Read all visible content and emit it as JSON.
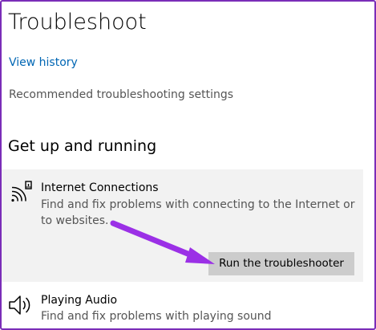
{
  "page": {
    "title": "Troubleshoot",
    "view_history_link": "View history",
    "recommended_heading": "Recommended troubleshooting settings",
    "section_heading": "Get up and running"
  },
  "items": [
    {
      "title": "Internet Connections",
      "description": "Find and fix problems with connecting to the Internet or to websites.",
      "icon": "wifi-signal-icon",
      "button_label": "Run the troubleshooter"
    },
    {
      "title": "Playing Audio",
      "description": "Find and fix problems with playing sound",
      "icon": "speaker-icon"
    }
  ],
  "colors": {
    "link": "#0066b4",
    "annotation_arrow": "#9b30e6",
    "frame_border": "#7a2db8",
    "selected_background": "#f2f2f2",
    "button_background": "#cccccc"
  }
}
